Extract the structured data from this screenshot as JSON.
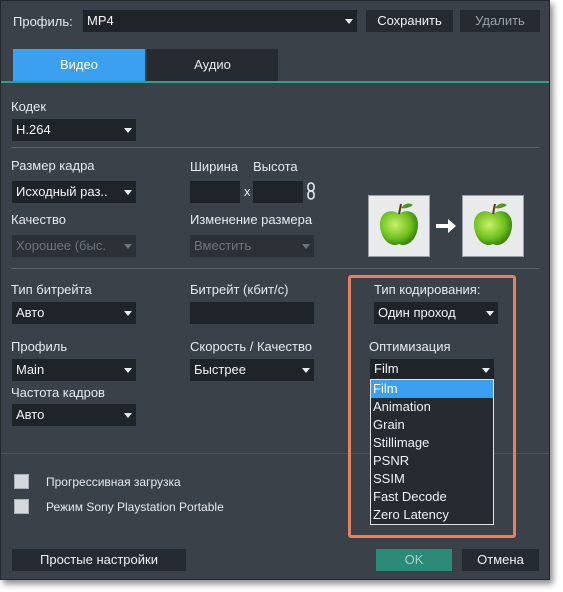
{
  "header": {
    "profile_label": "Профиль:",
    "profile_value": "MP4",
    "save_label": "Сохранить",
    "delete_label": "Удалить"
  },
  "tabs": [
    {
      "label": "Видео",
      "active": true
    },
    {
      "label": "Аудио",
      "active": false
    }
  ],
  "codec": {
    "label": "Кодек",
    "value": "H.264"
  },
  "frame_size": {
    "label": "Размер кадра",
    "value": "Исходный раз.."
  },
  "width_label": "Ширина",
  "height_label": "Высота",
  "times": "x",
  "quality": {
    "label": "Качество",
    "value": "Хорошее (быс."
  },
  "resize": {
    "label": "Изменение размера",
    "value": "Вместить"
  },
  "bitrate_type": {
    "label": "Тип битрейта",
    "value": "Авто"
  },
  "bitrate": {
    "label": "Битрейт (кбит/с)",
    "value": ""
  },
  "encoding_type": {
    "label": "Тип кодирования:",
    "value": "Один проход"
  },
  "profile": {
    "label": "Профиль",
    "value": "Main"
  },
  "speed_quality": {
    "label": "Скорость / Качество",
    "value": "Быстрее"
  },
  "optimization": {
    "label": "Оптимизация",
    "value": "Film",
    "options": [
      "Film",
      "Animation",
      "Grain",
      "Stillimage",
      "PSNR",
      "SSIM",
      "Fast Decode",
      "Zero Latency"
    ]
  },
  "framerate": {
    "label": "Частота кадров",
    "value": "Авто"
  },
  "progressive": {
    "label": "Прогрессивная загрузка",
    "checked": false
  },
  "psp": {
    "label": "Режим Sony Playstation Portable",
    "checked": false
  },
  "footer": {
    "simple_label": "Простые настройки",
    "ok_label": "OK",
    "cancel_label": "Отмена"
  },
  "colors": {
    "accent": "#3aa0ef",
    "ok": "#2c8a78",
    "highlight": "#e8805f"
  },
  "icons": {
    "link": "chain-link-icon",
    "arrow": "right-arrow-icon",
    "apple": "green-apple-icon"
  }
}
